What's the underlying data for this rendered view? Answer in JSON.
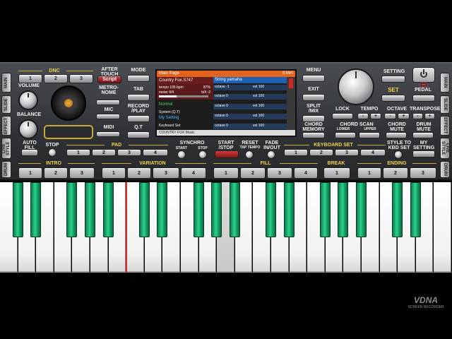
{
  "tabs_left": [
    "MAIN",
    "SLIDE",
    "EFFECT",
    "LIVE STYLE",
    "DRUM"
  ],
  "tabs_right": [
    "MAIN",
    "SLIDE",
    "EFFECT",
    "LIVE STYLE",
    "DRUM"
  ],
  "dnc": {
    "label": "DNC",
    "buttons": [
      "1",
      "2",
      "3"
    ],
    "after_touch": "AFTER TOUCH",
    "script": "Script",
    "metronome": "METRO- NOME",
    "mic": "MIC",
    "midi": "MIDI"
  },
  "volume_label": "VOLUME",
  "balance_label": "BALANCE",
  "mode_buttons": [
    "MODE",
    "TAB",
    "RECORD /PLAY",
    "Q.T"
  ],
  "screen": {
    "header": "Main Page",
    "header_right": "0:M#!",
    "style_name": "Country Fox.S747",
    "tempo": "tempo 105 bpm",
    "tempo_pct": "87%",
    "meter": "meter 4/4",
    "key": "b/# -2",
    "normal": "Normal",
    "system": "System (Q.T)",
    "my_setting": "My Setting",
    "keyboard_set": "Keyboard Set",
    "footer": "COUNTRY FOX Music",
    "voices": [
      {
        "name": "String yamaha",
        "octave": "",
        "vol": ""
      },
      {
        "name": "",
        "octave": "octave -1",
        "vol": "vol 100"
      },
      {
        "name": "",
        "octave": "octave 0",
        "vol": "vol 100"
      },
      {
        "name": "",
        "octave": "octave 0",
        "vol": "vol 100"
      },
      {
        "name": "",
        "octave": "octave 0",
        "vol": "vol 100"
      },
      {
        "name": "",
        "octave": "octave 0",
        "vol": "vol 100"
      }
    ]
  },
  "menu_buttons": [
    "MENU",
    "EXIT",
    "SPLIT /MIX",
    "CHORD MEMORY"
  ],
  "right": {
    "setting": "SETTING",
    "set": "SET",
    "pedal": "PEDAL",
    "lock": "LOCK",
    "tempo": "TEMPO",
    "octave": "OCTAVE",
    "transpose": "TRANSPOSE",
    "chord_scan": "CHORD SCAN",
    "lower": "LOWER",
    "upper": "UPPER",
    "chord_mute": "CHORD MUTE",
    "drum_mute": "DRUM MUTE",
    "minus": "-",
    "plus": "+"
  },
  "row3": {
    "auto_fill": "AUTO FILL",
    "stop": "STOP",
    "pad": "PAD",
    "pad_buttons": [
      "1",
      "2",
      "3",
      "4"
    ],
    "synchro": "SYNCHRO",
    "sync_start": "START",
    "sync_stop": "STOP",
    "start_stop": "START /STOP",
    "reset": "RESET",
    "tap_tempo": "TAP TEMPO",
    "fade": "FADE IN/OUT",
    "keyboard_set": "KEYBOARD SET",
    "kb_buttons": [
      "1",
      "2",
      "3",
      "4"
    ],
    "style_to_kbd": "STYLE TO KBD SET",
    "my_setting": "MY SETTING"
  },
  "row4": {
    "intro": "INTRO",
    "intro_buttons": [
      "1",
      "2",
      "3"
    ],
    "variation": "VARIATION",
    "variation_buttons": [
      "1",
      "2",
      "3",
      "4"
    ],
    "fill": "FILL",
    "fill_buttons": [
      "1",
      "2",
      "3",
      "4"
    ],
    "break": "BREAK",
    "break_buttons": [
      "1"
    ],
    "ending": "ENDING",
    "ending_buttons": [
      "1",
      "2",
      "3"
    ]
  },
  "watermark": {
    "brand": "VDNA",
    "sub": "SCREEN RECORDER"
  }
}
